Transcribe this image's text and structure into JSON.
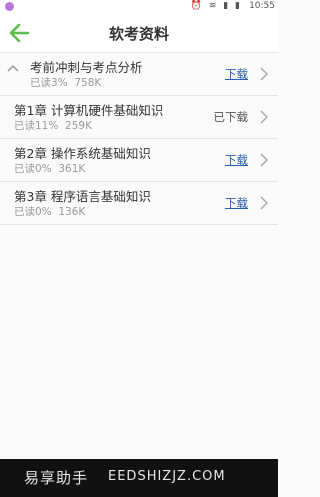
{
  "status": {
    "time": "10:55",
    "icons": "⏰ ≋ ▮ ▮"
  },
  "header": {
    "title": "软考资料"
  },
  "items": [
    {
      "name": "考前冲刺与考点分析",
      "read": "已读3%",
      "size": "758K",
      "action": "下载",
      "state": "link"
    },
    {
      "name": "第1章 计算机硬件基础知识",
      "read": "已读11%",
      "size": "259K",
      "action": "已下载",
      "state": "done"
    },
    {
      "name": "第2章 操作系统基础知识",
      "read": "已读0%",
      "size": "361K",
      "action": "下载",
      "state": "link"
    },
    {
      "name": "第3章 程序语言基础知识",
      "read": "已读0%",
      "size": "136K",
      "action": "下载",
      "state": "link"
    }
  ],
  "watermark": {
    "cn": "易享助手",
    "en": "EEDSHIZJZ.COM"
  },
  "colors": {
    "accent": "#2a5db0",
    "back_arrow": "#5cbf49"
  }
}
